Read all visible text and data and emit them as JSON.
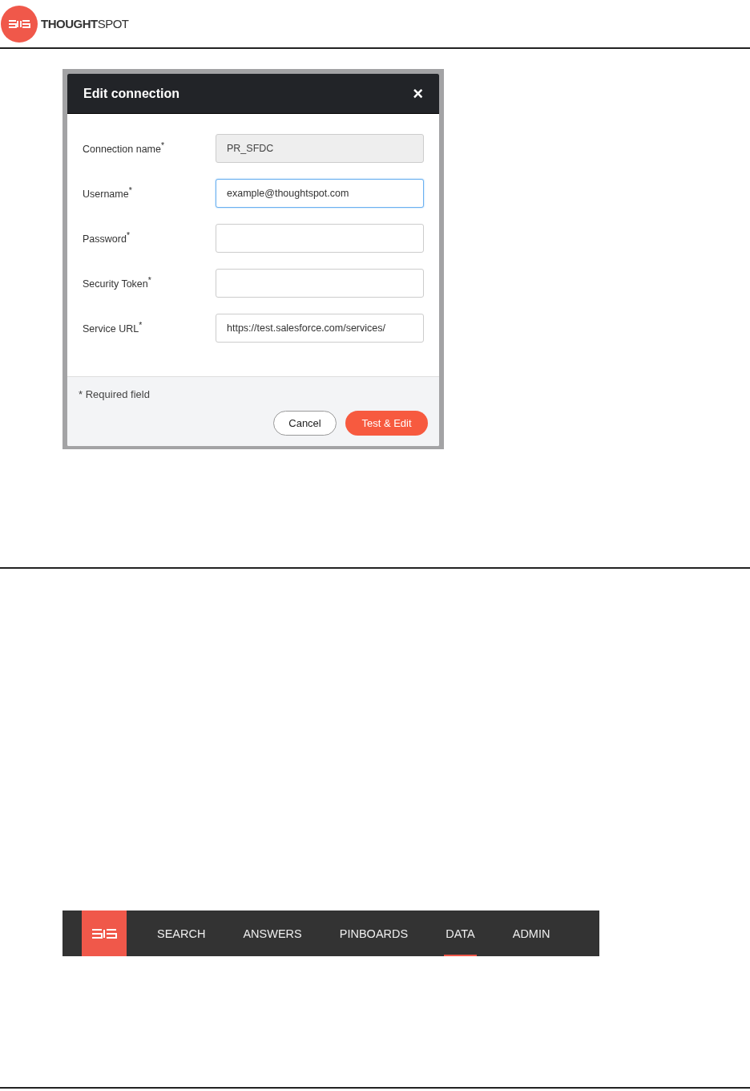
{
  "header": {
    "logo_text": "**THOUGHT**SPOT"
  },
  "dialog": {
    "title": "Edit connection",
    "close": "×",
    "fields": [
      {
        "label": "Connection name$^{*}$",
        "value": "PR_SFDC",
        "disabled": true,
        "focused": false
      },
      {
        "label": "Username$^{*}$",
        "value": "example@thoughtspot.com",
        "disabled": false,
        "focused": true
      },
      {
        "label": "Password$^{*}$",
        "disabled": false,
        "focused": false
      },
      {
        "label": "Security Token$^{*}$",
        "disabled": false,
        "focused": false
      },
      {
        "label": "Service URL$^{*}$",
        "value": "https://test.salesforce.com/services/",
        "disabled": false,
        "focused": false
      }
    ],
    "note": "* Required field",
    "buttons": [
      {
        "label": "Cancel",
        "kind": "secondary"
      },
      {
        "label": "Test & Edit",
        "kind": "primary"
      }
    ]
  },
  "nav": {
    "items": [
      {
        "label": "SEARCH",
        "selected": false
      },
      {
        "label": "ANSWERS",
        "selected": false
      },
      {
        "label": "PINBOARDS",
        "selected": false
      },
      {
        "label": "DATA",
        "selected": true
      },
      {
        "label": "ADMIN",
        "selected": false
      }
    ]
  }
}
